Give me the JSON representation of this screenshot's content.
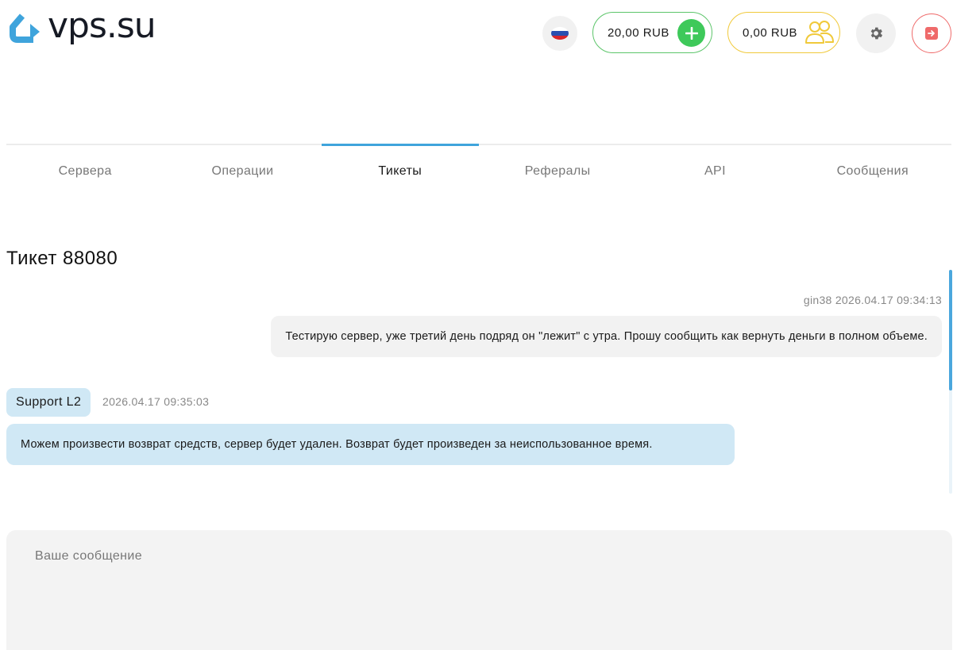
{
  "header": {
    "logo_text": "vps.su",
    "language_icon": "russia-flag-icon",
    "balance": {
      "amount": "20,00 RUB",
      "add_icon": "plus-icon",
      "accent_color": "#3ec95a"
    },
    "referral_balance": {
      "amount": "0,00 RUB",
      "icon": "people-icon",
      "accent_color": "#f0c93a"
    },
    "settings_icon": "gear-icon",
    "logout_icon": "logout-icon"
  },
  "tabs": [
    {
      "label": "Сервера",
      "active": false
    },
    {
      "label": "Операции",
      "active": false
    },
    {
      "label": "Тикеты",
      "active": true
    },
    {
      "label": "Рефералы",
      "active": false
    },
    {
      "label": "API",
      "active": false
    },
    {
      "label": "Сообщения",
      "active": false
    }
  ],
  "ticket": {
    "title": "Тикет 88080",
    "messages": [
      {
        "author": "gin38",
        "timestamp": "2026.04.17 09:34:13",
        "meta": "gin38 2026.04.17 09:34:13",
        "text": "Тестирую сервер, уже третий день подряд он \"лежит\" с утра. Прошу сообщить как вернуть деньги в полном объеме."
      },
      {
        "author": "Support L2",
        "timestamp": "2026.04.17 09:35:03",
        "text": "Можем произвести возврат средств, сервер будет удален. Возврат будет произведен за неиспользованное время."
      }
    ]
  },
  "composer": {
    "placeholder": "Ваше сообщение",
    "value": ""
  },
  "colors": {
    "accent_blue": "#3fa4dc",
    "support_bubble": "#d0e8f5",
    "user_bubble": "#f2f2f2",
    "logout_red": "#ef6a6a"
  }
}
